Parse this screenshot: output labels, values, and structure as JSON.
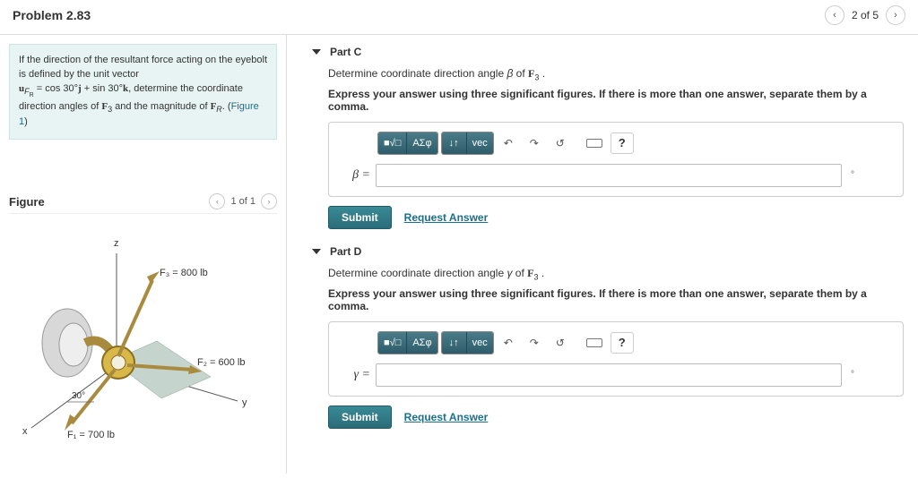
{
  "header": {
    "title": "Problem 2.83",
    "counter": "2 of 5"
  },
  "prompt": {
    "line1_a": "If the direction of the resultant force acting on the eyebolt is defined by the unit vector",
    "line2_a": "u",
    "line2_sub": "F",
    "line2_subb": "R",
    "line2_b": " = cos 30°",
    "line2_j": "j",
    "line2_c": " + sin 30°",
    "line2_k": "k",
    "line2_d": ", determine the coordinate direction angles of ",
    "line2_F3": "F",
    "line2_3": "3",
    "line2_e": " and the magnitude of ",
    "line2_FR": "F",
    "line2_R": "R",
    "line2_f": ". (",
    "figure_link": "Figure 1",
    "line2_g": ")"
  },
  "figure": {
    "label": "Figure",
    "counter": "1 of 1"
  },
  "figure_labels": {
    "z": "z",
    "y": "y",
    "x": "x",
    "F3": "F₃ = 800 lb",
    "F2": "F₂ = 600 lb",
    "F1": "F₁ = 700 lb",
    "angle": "30°"
  },
  "toolbar": {
    "tmpl": "√□",
    "greek": "ΑΣφ",
    "subsup": "↓↑",
    "vec": "vec",
    "undo": "↶",
    "redo": "↷",
    "reset": "↺",
    "help": "?"
  },
  "parts": [
    {
      "id": "C",
      "title": "Part C",
      "desc_a": "Determine coordinate direction angle ",
      "sym": "β",
      "desc_b": " of ",
      "F": "F",
      "n": "3",
      "dot": " .",
      "instr": "Express your answer using three significant figures. If there is more than one answer, separate them by a comma.",
      "var": "β =",
      "unit": "°",
      "submit": "Submit",
      "req": "Request Answer"
    },
    {
      "id": "D",
      "title": "Part D",
      "desc_a": "Determine coordinate direction angle ",
      "sym": "γ",
      "desc_b": " of ",
      "F": "F",
      "n": "3",
      "dot": " .",
      "instr": "Express your answer using three significant figures. If there is more than one answer, separate them by a comma.",
      "var": "γ =",
      "unit": "°",
      "submit": "Submit",
      "req": "Request Answer"
    }
  ]
}
